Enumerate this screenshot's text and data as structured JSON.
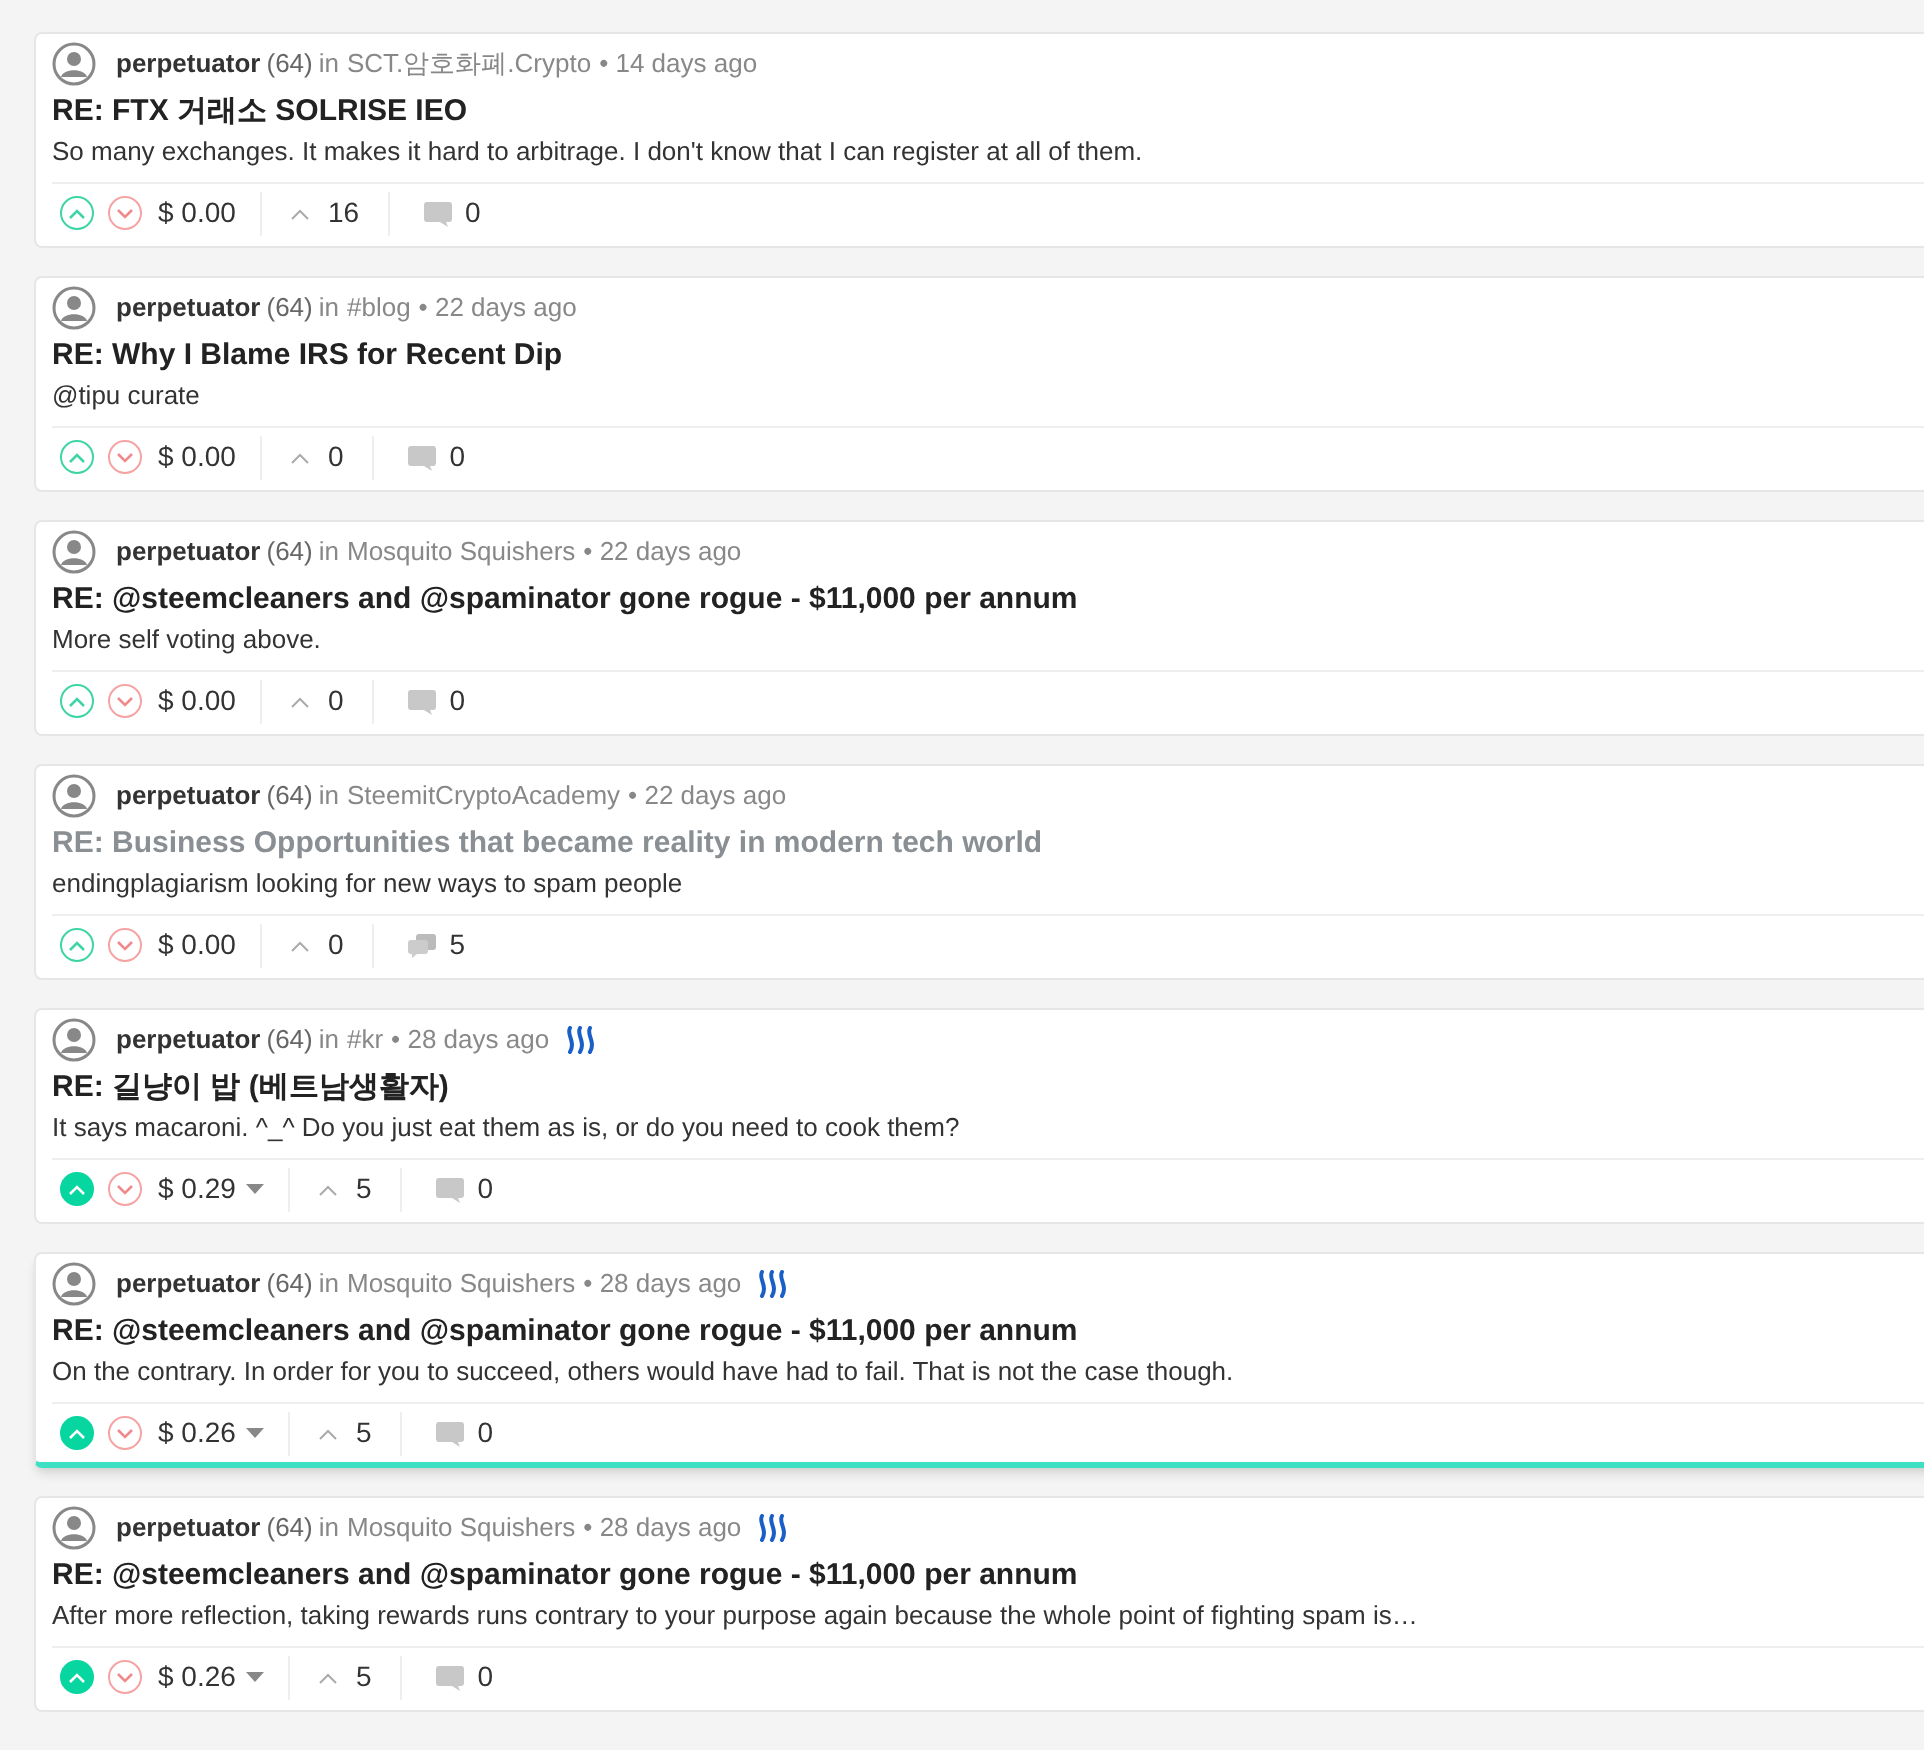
{
  "posts": [
    {
      "author": "perpetuator",
      "reputation": "(64)",
      "in": "in",
      "community": "SCT.암호화폐.Crypto",
      "time": "• 14 days ago",
      "steem_badge": false,
      "title": "RE: FTX 거래소 SOLRISE IEO",
      "title_muted": false,
      "body": "So many exchanges. It makes it hard to arbitrage. I don't know that I can register at all of them.",
      "upvoted": false,
      "payout": "$ 0.00",
      "payout_dropdown": false,
      "votes": "16",
      "comments": "0",
      "comments_stacked": false,
      "highlighted": false
    },
    {
      "author": "perpetuator",
      "reputation": "(64)",
      "in": "in",
      "community": "#blog",
      "time": "• 22 days ago",
      "steem_badge": false,
      "title": "RE: Why I Blame IRS for Recent Dip",
      "title_muted": false,
      "body": "@tipu curate",
      "upvoted": false,
      "payout": "$ 0.00",
      "payout_dropdown": false,
      "votes": "0",
      "comments": "0",
      "comments_stacked": false,
      "highlighted": false
    },
    {
      "author": "perpetuator",
      "reputation": "(64)",
      "in": "in",
      "community": "Mosquito Squishers",
      "time": "• 22 days ago",
      "steem_badge": false,
      "title": "RE: @steemcleaners and @spaminator gone rogue - $11,000 per annum",
      "title_muted": false,
      "body": "More self voting above.",
      "upvoted": false,
      "payout": "$ 0.00",
      "payout_dropdown": false,
      "votes": "0",
      "comments": "0",
      "comments_stacked": false,
      "highlighted": false
    },
    {
      "author": "perpetuator",
      "reputation": "(64)",
      "in": "in",
      "community": "SteemitCryptoAcademy",
      "time": "• 22 days ago",
      "steem_badge": false,
      "title": "RE: Business Opportunities that became reality in modern tech world",
      "title_muted": true,
      "body": "endingplagiarism looking for new ways to spam people",
      "upvoted": false,
      "payout": "$ 0.00",
      "payout_dropdown": false,
      "votes": "0",
      "comments": "5",
      "comments_stacked": true,
      "highlighted": false
    },
    {
      "author": "perpetuator",
      "reputation": "(64)",
      "in": "in",
      "community": "#kr",
      "time": "• 28 days ago",
      "steem_badge": true,
      "title": "RE: 길냥이 밥 (베트남생활자)",
      "title_muted": false,
      "body": "It says macaroni. ^_^ Do you just eat them as is, or do you need to cook them?",
      "upvoted": true,
      "payout": "$ 0.29",
      "payout_dropdown": true,
      "votes": "5",
      "comments": "0",
      "comments_stacked": false,
      "highlighted": false
    },
    {
      "author": "perpetuator",
      "reputation": "(64)",
      "in": "in",
      "community": "Mosquito Squishers",
      "time": "• 28 days ago",
      "steem_badge": true,
      "title": "RE: @steemcleaners and @spaminator gone rogue - $11,000 per annum",
      "title_muted": false,
      "body": "On the contrary. In order for you to succeed, others would have had to fail. That is not the case though.",
      "upvoted": true,
      "payout": "$ 0.26",
      "payout_dropdown": true,
      "votes": "5",
      "comments": "0",
      "comments_stacked": false,
      "highlighted": true
    },
    {
      "author": "perpetuator",
      "reputation": "(64)",
      "in": "in",
      "community": "Mosquito Squishers",
      "time": "• 28 days ago",
      "steem_badge": true,
      "title": "RE: @steemcleaners and @spaminator gone rogue - $11,000 per annum",
      "title_muted": false,
      "body": "After more reflection, taking rewards runs contrary to your purpose again because the whole point of fighting spam is…",
      "upvoted": true,
      "payout": "$ 0.26",
      "payout_dropdown": true,
      "votes": "5",
      "comments": "0",
      "comments_stacked": false,
      "highlighted": false
    }
  ]
}
